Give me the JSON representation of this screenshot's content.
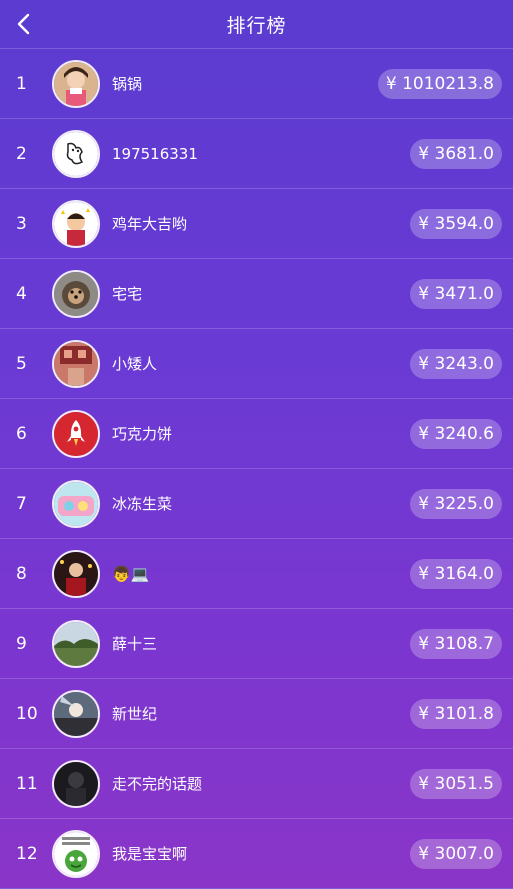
{
  "header": {
    "title": "排行榜"
  },
  "rows": [
    {
      "rank": "1",
      "name": "锅锅",
      "amount": "¥ 1010213.8"
    },
    {
      "rank": "2",
      "name": "197516331",
      "amount": "¥ 3681.0"
    },
    {
      "rank": "3",
      "name": "鸡年大吉哟",
      "amount": "¥ 3594.0"
    },
    {
      "rank": "4",
      "name": "宅宅",
      "amount": "¥ 3471.0"
    },
    {
      "rank": "5",
      "name": "小矮人",
      "amount": "¥ 3243.0"
    },
    {
      "rank": "6",
      "name": "巧克力饼",
      "amount": "¥ 3240.6"
    },
    {
      "rank": "7",
      "name": "冰冻生菜",
      "amount": "¥ 3225.0"
    },
    {
      "rank": "8",
      "name": "👦💻",
      "amount": "¥ 3164.0"
    },
    {
      "rank": "9",
      "name": "薛十三",
      "amount": "¥ 3108.7"
    },
    {
      "rank": "10",
      "name": "新世纪",
      "amount": "¥ 3101.8"
    },
    {
      "rank": "11",
      "name": "走不完的话题",
      "amount": "¥ 3051.5"
    },
    {
      "rank": "12",
      "name": "我是宝宝啊",
      "amount": "¥ 3007.0"
    }
  ],
  "colors": {
    "background_top": "#5b3bd0",
    "background_bottom": "#8a35c8",
    "pill": "rgba(255,255,255,0.25)"
  },
  "icons": {
    "back": "chevron-left-icon"
  }
}
